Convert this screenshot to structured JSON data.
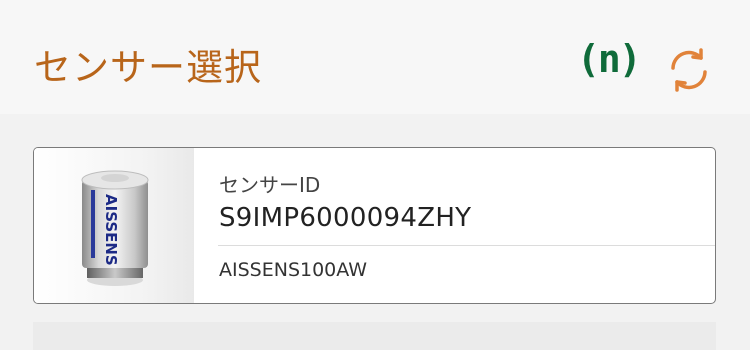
{
  "header": {
    "title": "センサー選択",
    "count_badge": "(n)",
    "refresh_icon": "refresh-icon",
    "title_color": "#b8651a",
    "badge_color": "#0f6b3a"
  },
  "sensor_list": [
    {
      "image_icon": "sensor-device-image",
      "image_text": "AISSENS",
      "id_label": "センサーID",
      "id_value": "S9IMP6000094ZHY",
      "model": "AISSENS100AW"
    }
  ]
}
